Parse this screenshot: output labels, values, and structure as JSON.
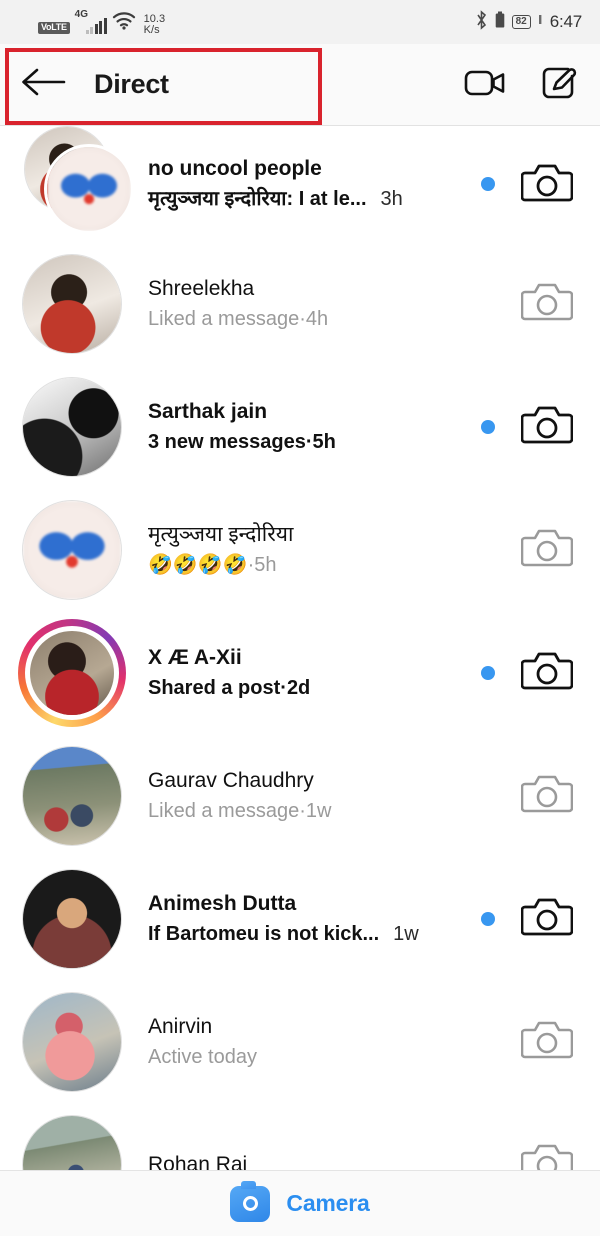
{
  "status_bar": {
    "volte": "VoLTE",
    "network_type": "4G",
    "speed_value": "10.3",
    "speed_unit": "K/s",
    "bluetooth_icon": "bluetooth-icon",
    "battery_percent": "82",
    "time": "6:47"
  },
  "header": {
    "back_icon": "back-arrow-icon",
    "title": "Direct",
    "video_call_icon": "video-camera-icon",
    "compose_icon": "compose-pencil-icon",
    "highlight_color": "#d9232d"
  },
  "colors": {
    "unread_dot": "#3897f0",
    "accent": "#2b8ef0",
    "muted_text": "#9a9a9a",
    "primary_text": "#111111"
  },
  "conversations": [
    {
      "name": "no uncool people",
      "preview": "मृत्युञ्जया इन्दोरिया: I at le...",
      "timestamp": "3h",
      "separator": "",
      "unread": true,
      "avatar_kind": "group",
      "story_ring": false,
      "camera_icon": "camera-icon"
    },
    {
      "name": "Shreelekha",
      "preview": "Liked a message",
      "timestamp": "4h",
      "separator": " · ",
      "unread": false,
      "avatar_kind": "single",
      "story_ring": false,
      "camera_icon": "camera-icon"
    },
    {
      "name": "Sarthak jain",
      "preview": "3 new messages",
      "timestamp": "5h",
      "separator": " · ",
      "unread": true,
      "avatar_kind": "single",
      "story_ring": false,
      "camera_icon": "camera-icon"
    },
    {
      "name": "मृत्युञ्जया इन्दोरिया",
      "preview": "🤣🤣🤣🤣",
      "timestamp": "5h",
      "separator": " · ",
      "unread": false,
      "avatar_kind": "single",
      "story_ring": false,
      "camera_icon": "camera-icon"
    },
    {
      "name": "X Æ A-Xii",
      "preview": "Shared a post",
      "timestamp": "2d",
      "separator": " · ",
      "unread": true,
      "avatar_kind": "single",
      "story_ring": true,
      "camera_icon": "camera-icon"
    },
    {
      "name": "Gaurav Chaudhry",
      "preview": "Liked a message",
      "timestamp": "1w",
      "separator": " · ",
      "unread": false,
      "avatar_kind": "single",
      "story_ring": false,
      "camera_icon": "camera-icon"
    },
    {
      "name": "Animesh Dutta",
      "preview": "If Bartomeu is not kick...",
      "timestamp": "1w",
      "separator": "",
      "unread": true,
      "avatar_kind": "single",
      "story_ring": false,
      "camera_icon": "camera-icon"
    },
    {
      "name": "Anirvin",
      "preview": "Active today",
      "timestamp": "",
      "separator": "",
      "unread": false,
      "avatar_kind": "single",
      "story_ring": false,
      "camera_icon": "camera-icon"
    },
    {
      "name": "Rohan Raj",
      "preview": "",
      "timestamp": "",
      "separator": "",
      "unread": false,
      "avatar_kind": "single",
      "story_ring": false,
      "camera_icon": "camera-icon"
    }
  ],
  "bottom_bar": {
    "camera_icon": "camera-badge-icon",
    "label": "Camera"
  }
}
